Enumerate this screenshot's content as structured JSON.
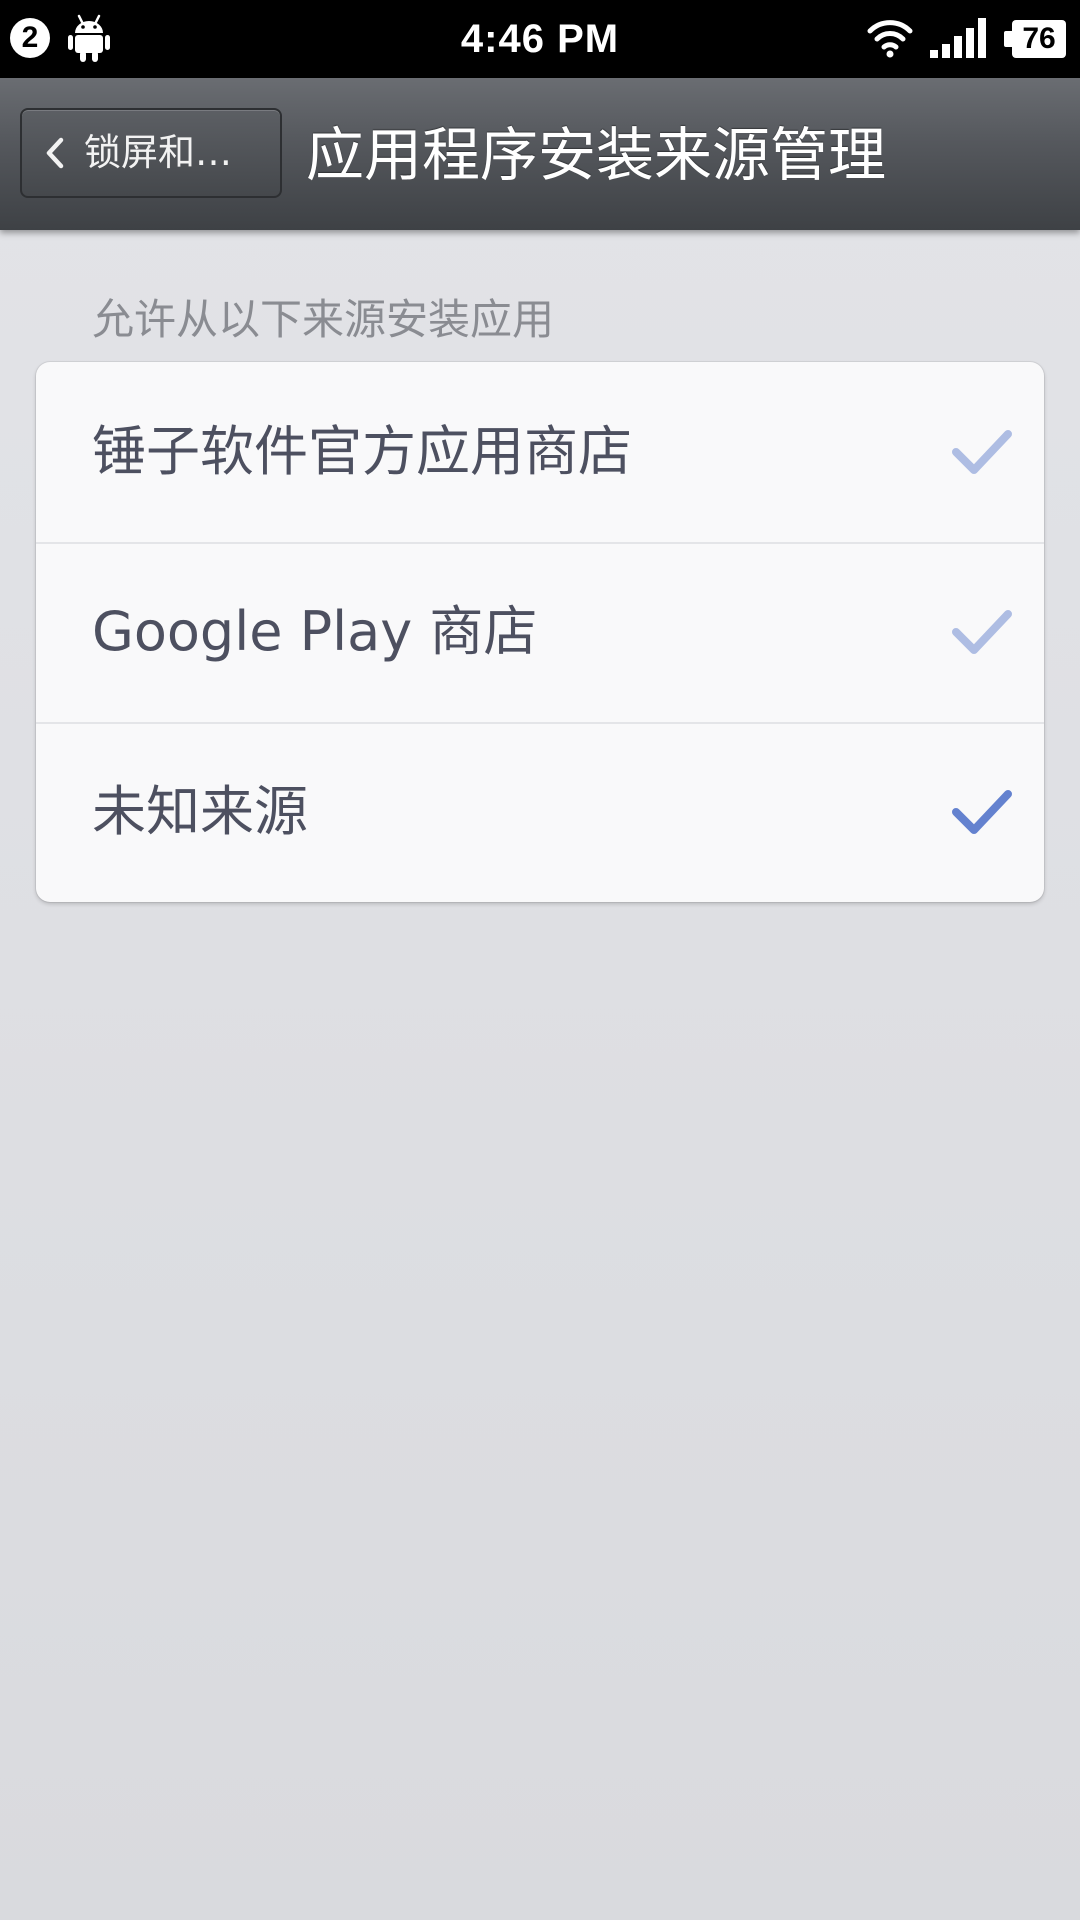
{
  "status_bar": {
    "notification_count": "2",
    "time": "4:46 PM",
    "battery_level": "76",
    "icons": [
      "android-icon",
      "wifi-icon",
      "signal-icon",
      "battery-icon"
    ]
  },
  "title_bar": {
    "back_label": "锁屏和…",
    "title": "应用程序安装来源管理"
  },
  "section_header": "允许从以下来源安装应用",
  "colors": {
    "check_light": "#aebde3",
    "check_active": "#6482cf",
    "item_text": "#4d5060"
  },
  "sources": [
    {
      "label": "锤子软件官方应用商店",
      "icon": "check-icon",
      "state": "light"
    },
    {
      "label": "Google Play 商店",
      "icon": "check-icon",
      "state": "light"
    },
    {
      "label": "未知来源",
      "icon": "check-icon",
      "state": "active"
    }
  ]
}
